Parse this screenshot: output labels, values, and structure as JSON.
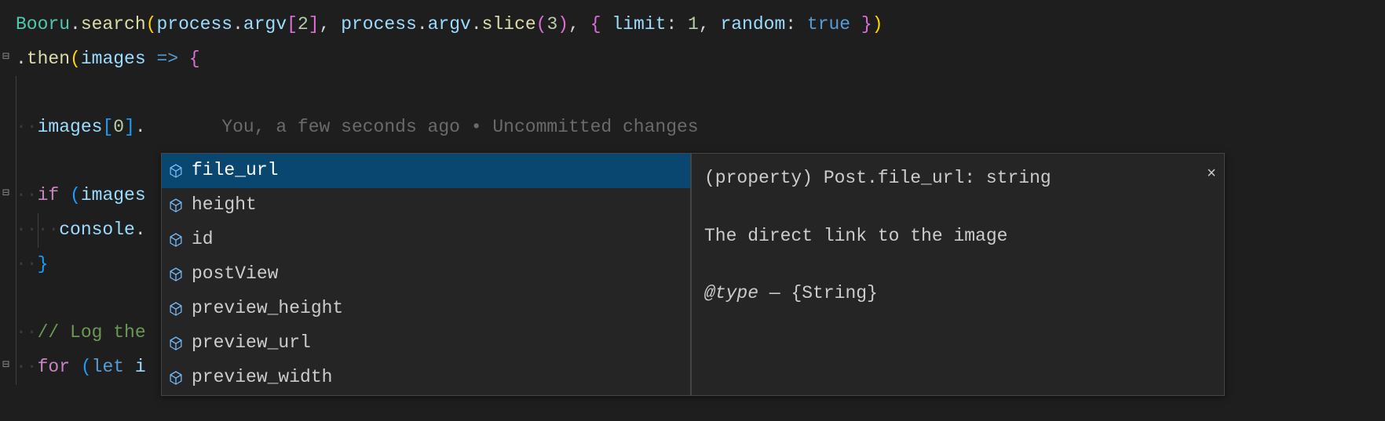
{
  "code": {
    "line1": {
      "booru": "Booru",
      "dot1": ".",
      "search": "search",
      "open": "(",
      "process1": "process",
      "dot2": ".",
      "argv1": "argv",
      "br1o": "[",
      "idx2": "2",
      "br1c": "]",
      "comma1": ",",
      "space1": " ",
      "process2": "process",
      "dot3": ".",
      "argv2": "argv",
      "dot4": ".",
      "slice": "slice",
      "slo": "(",
      "idx3": "3",
      "slc": ")",
      "comma2": ",",
      "space2": " ",
      "obo": "{",
      "space3": " ",
      "limit": "limit",
      "col1": ":",
      "space4": " ",
      "one": "1",
      "comma3": ",",
      "space5": " ",
      "random": "random",
      "col2": ":",
      "space6": " ",
      "true": "true",
      "space7": " ",
      "obc": "}",
      "close": ")"
    },
    "line2": {
      "dot": ".",
      "then": "then",
      "open": "(",
      "images": "images",
      "arrow": " => ",
      "brace": "{"
    },
    "line4": {
      "images": "images",
      "bro": "[",
      "zero": "0",
      "brc": "]",
      "dot": "."
    },
    "line6": {
      "if": "if",
      "sp": " ",
      "open": "(",
      "images": "images"
    },
    "line7": {
      "console": "console",
      "dot": "."
    },
    "line8": {
      "brace": "}"
    },
    "line10": {
      "comment": "// Log the"
    },
    "line11": {
      "for": "for",
      "sp": " ",
      "open": "(",
      "let": "let",
      "sp2": " ",
      "i": "i"
    }
  },
  "gitlens": "You, a few seconds ago • Uncommitted changes",
  "autocomplete": {
    "items": [
      {
        "label": "file_url"
      },
      {
        "label": "height"
      },
      {
        "label": "id"
      },
      {
        "label": "postView"
      },
      {
        "label": "preview_height"
      },
      {
        "label": "preview_url"
      },
      {
        "label": "preview_width"
      }
    ],
    "selected": 0,
    "doc": {
      "signature": "(property) Post.file_url: string",
      "description": "The direct link to the image",
      "tag_at": "@type",
      "tag_sep": " — ",
      "tag_val": "{String}"
    }
  }
}
